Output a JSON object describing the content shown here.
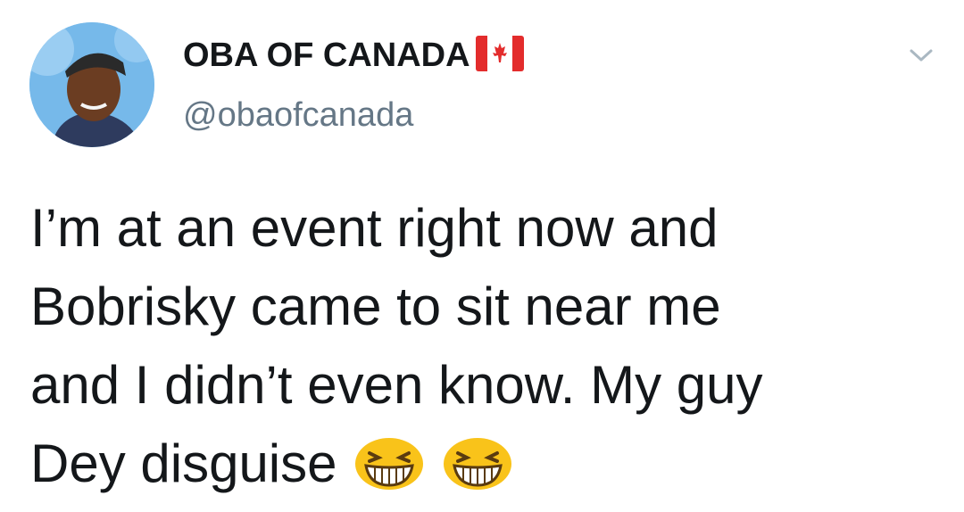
{
  "author": {
    "display_name": "OBA OF CANADA",
    "handle": "@obaofcanada",
    "flag_icon": "canada-flag-icon"
  },
  "tweet": {
    "lines": [
      "I’m at an event right now and",
      "Bobrisky came to sit near me",
      "and I didn’t even know. My guy",
      "Dey disguise"
    ],
    "trailing_emoji": [
      "grinning-squinting-face-icon",
      "grinning-squinting-face-icon"
    ]
  },
  "colors": {
    "text_primary": "#14171a",
    "text_secondary": "#657786",
    "emoji_yellow": "#f9c31a"
  }
}
